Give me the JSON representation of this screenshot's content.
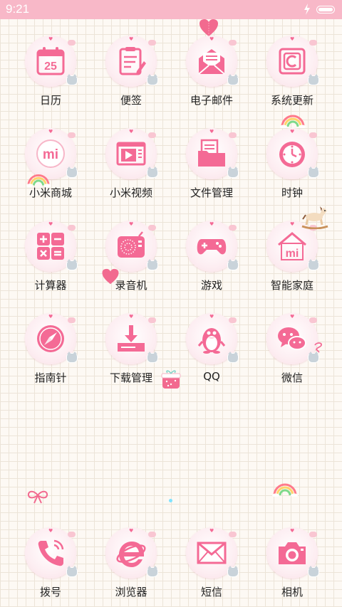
{
  "status_bar": {
    "time": "9:21"
  },
  "colors": {
    "accent_pink": "#f46a95",
    "status_bar_pink": "#f8b8c8",
    "disc_bg": "#fdeef2"
  },
  "apps": [
    {
      "label": "日历",
      "icon": "calendar-icon",
      "date_number": "25"
    },
    {
      "label": "便签",
      "icon": "notepad-icon"
    },
    {
      "label": "电子邮件",
      "icon": "email-envelope-icon"
    },
    {
      "label": "系统更新",
      "icon": "system-update-icon"
    },
    {
      "label": "小米商城",
      "icon": "mi-store-icon",
      "logo_text": "mi"
    },
    {
      "label": "小米视频",
      "icon": "video-player-icon"
    },
    {
      "label": "文件管理",
      "icon": "folder-icon"
    },
    {
      "label": "时钟",
      "icon": "clock-icon"
    },
    {
      "label": "计算器",
      "icon": "calculator-icon"
    },
    {
      "label": "录音机",
      "icon": "radio-recorder-icon"
    },
    {
      "label": "游戏",
      "icon": "gamepad-icon"
    },
    {
      "label": "智能家庭",
      "icon": "smart-home-icon",
      "logo_text": "mi"
    },
    {
      "label": "指南针",
      "icon": "compass-icon"
    },
    {
      "label": "下载管理",
      "icon": "download-icon"
    },
    {
      "label": "QQ",
      "icon": "qq-penguin-icon"
    },
    {
      "label": "微信",
      "icon": "wechat-icon"
    }
  ],
  "dock": [
    {
      "label": "拨号",
      "icon": "phone-icon"
    },
    {
      "label": "浏览器",
      "icon": "browser-icon"
    },
    {
      "label": "短信",
      "icon": "message-envelope-icon"
    },
    {
      "label": "相机",
      "icon": "camera-icon"
    }
  ]
}
